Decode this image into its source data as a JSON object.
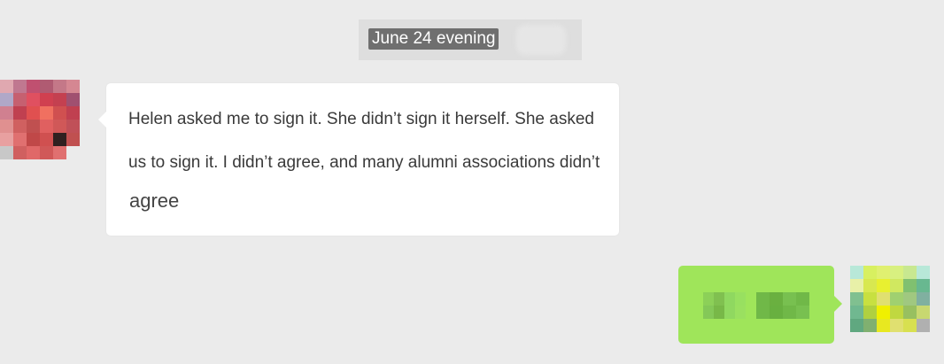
{
  "timestamp": "June 24 evening",
  "incoming_message": {
    "line1": "Helen asked me to sign it. She didn’t sign it herself. She asked",
    "line2": "us to sign it. I didn’t agree, and many alumni associations didn’t",
    "line3": "agree"
  },
  "outgoing_message": {
    "content_obscured": true
  },
  "colors": {
    "background": "#ebebeb",
    "incoming_bubble": "#ffffff",
    "outgoing_bubble": "#9fe55a",
    "timestamp_bg": "#6f6f6f"
  },
  "avatars": {
    "left_pixels": [
      "#e0a8b0",
      "#c07890",
      "#c05070",
      "#b05b72",
      "#c47888",
      "#d58792",
      "#ebebeb",
      "#b0a8c8",
      "#c66070",
      "#e05060",
      "#d04050",
      "#c44050",
      "#a05070",
      "#ebebeb",
      "#d08090",
      "#c04050",
      "#e05050",
      "#f07060",
      "#d05050",
      "#c04050",
      "#ebebeb",
      "#e09090",
      "#d06060",
      "#c05050",
      "#e06060",
      "#d05858",
      "#c05058",
      "#ebebeb",
      "#e8a0a0",
      "#e07070",
      "#c04848",
      "#d05050",
      "#302020",
      "#c05050",
      "#ebebeb",
      "#c8c8c8",
      "#d06060",
      "#e06868",
      "#d05858",
      "#e07070",
      "#ebebeb",
      "#ebebeb"
    ],
    "right_pixels": [
      "#b8e8d8",
      "#d8f060",
      "#e0f070",
      "#d8f080",
      "#c8e890",
      "#b8e8d8",
      "#ebebeb",
      "#e8f0a8",
      "#d8e850",
      "#e8f030",
      "#d0e860",
      "#80c070",
      "#68b890",
      "#ebebeb",
      "#80c090",
      "#c8e040",
      "#e0e070",
      "#a0d070",
      "#a0c880",
      "#80b0a0",
      "#ebebeb",
      "#70b890",
      "#b0d040",
      "#f0f000",
      "#c0d840",
      "#98c060",
      "#c8d870",
      "#ebebeb",
      "#60a880",
      "#80b070",
      "#e8e820",
      "#e0e070",
      "#d8e050",
      "#b0b0b0",
      "#ebebeb",
      "#ebebeb",
      "#ebebeb",
      "#ebebeb",
      "#ebebeb",
      "#ebebeb",
      "#ebebeb",
      "#ebebeb"
    ]
  }
}
